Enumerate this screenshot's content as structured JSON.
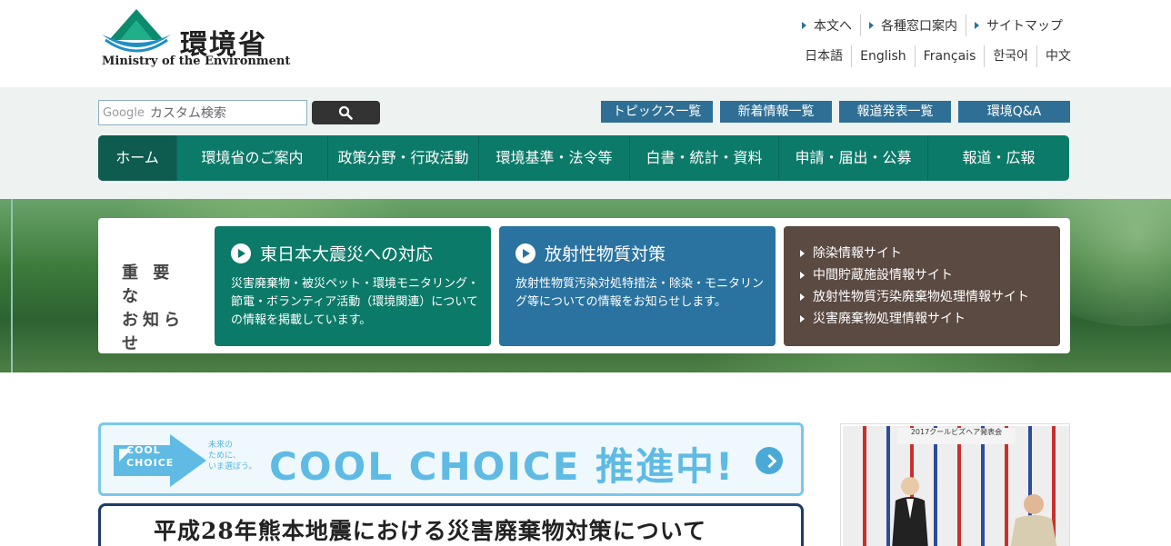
{
  "header": {
    "logo_ja": "環境省",
    "logo_en": "Ministry of the Environment",
    "util_links": [
      "本文へ",
      "各種窓口案内",
      "サイトマップ"
    ],
    "languages": [
      "日本語",
      "English",
      "Français",
      "한국어",
      "中文"
    ]
  },
  "search": {
    "brand": "Google",
    "placeholder": "カスタム検索",
    "button_icon": "search-icon"
  },
  "quick_buttons": [
    "トピックス一覧",
    "新着情報一覧",
    "報道発表一覧",
    "環境Q&A"
  ],
  "global_nav": [
    "ホーム",
    "環境省のご案内",
    "政策分野・行政活動",
    "環境基準・法令等",
    "白書・統計・資料",
    "申請・届出・公募",
    "報道・広報"
  ],
  "notice": {
    "label_line1": "重 要 な",
    "label_line2": "お知らせ",
    "card1": {
      "title": "東日本大震災への対応",
      "desc": "災害廃棄物・被災ペット・環境モニタリング・節電・ボランティア活動（環境関連）についての情報を掲載しています。"
    },
    "card2": {
      "title": "放射性物質対策",
      "desc": "放射性物質汚染対処特措法・除染・モニタリング等についての情報をお知らせします。"
    },
    "card3_links": [
      "除染情報サイト",
      "中間貯蔵施設情報サイト",
      "放射性物質汚染廃棄物処理情報サイト",
      "災害廃棄物処理情報サイト"
    ]
  },
  "banners": {
    "cool_arrow_line1": "COOL",
    "cool_arrow_line2": "CHOICE",
    "cool_small_line1": "未来の",
    "cool_small_line2": "ために、",
    "cool_small_line3": "いま選ぼう。",
    "cool_main": "COOL CHOICE 推進中!",
    "kumamoto": "平成28年熊本地震における災害廃棄物対策について"
  },
  "photo": {
    "banner_text": "2017クールビズヘア発表会"
  },
  "colors": {
    "teal": "#0c7a69",
    "blue": "#2a73a0",
    "brown": "#5b4a42",
    "nav_blue": "#2f6f95",
    "cool_blue": "#5fbbe4"
  }
}
